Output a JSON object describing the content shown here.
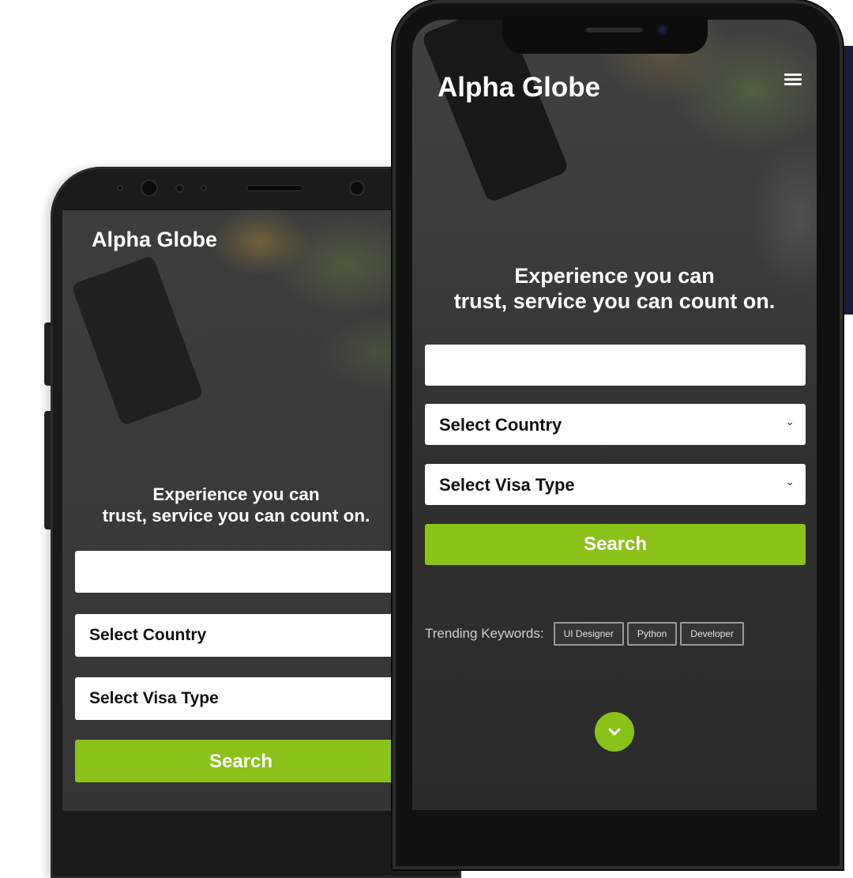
{
  "back_phone": {
    "app_title": "Alpha Globe",
    "heading_line1": "Experience you can",
    "heading_line2": "trust, service you can count on.",
    "search_input_value": "",
    "country_select": "Select Country",
    "visa_select": "Select Visa Type",
    "search_button": "Search"
  },
  "front_phone": {
    "app_title": "Alpha Globe",
    "menu_icon": "hamburger-icon",
    "heading_line1": "Experience you can",
    "heading_line2": "trust, service you can count on.",
    "search_input_value": "",
    "country_select": "Select Country",
    "visa_select": "Select Visa Type",
    "search_button": "Search",
    "trending_label": "Trending Keywords:",
    "keywords": [
      "UI Designer",
      "Python",
      "Developer"
    ],
    "scroll_icon": "chevron-down-icon"
  },
  "colors": {
    "accent": "#8bc21a",
    "screen_bg": "#2f2f2f",
    "text": "#ffffff"
  }
}
